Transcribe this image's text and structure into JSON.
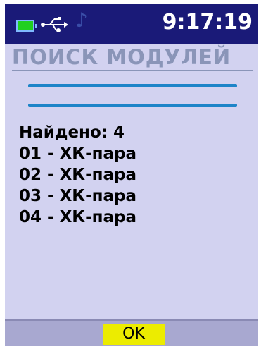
{
  "status": {
    "time": "9:17:19",
    "icons": [
      "battery-icon",
      "usb-icon",
      "music-note-icon"
    ],
    "battery_color": "#21d021",
    "bar_color": "#1a1a78"
  },
  "screen": {
    "title": "ПОИСК МОДУЛЕЙ",
    "found": "Найдено: 4",
    "modules": [
      "01 - ХК-пара",
      "02 - ХК-пара",
      "03 - ХК-пара",
      "04 - ХК-пара"
    ]
  },
  "softkeys": {
    "ok_label": "OK"
  },
  "colors": {
    "background": "#d2d2f0",
    "title": "#8a95b8",
    "progress": "#1d84c8",
    "ok_button": "#ecec00"
  }
}
